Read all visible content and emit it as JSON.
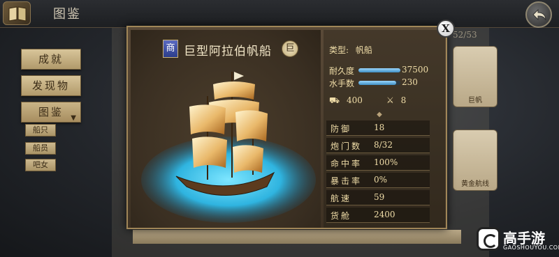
{
  "header": {
    "title": "图鉴"
  },
  "side_menu": {
    "items": [
      {
        "label": "成就"
      },
      {
        "label": "发现物"
      },
      {
        "label": "图鉴"
      }
    ],
    "sub_items": [
      {
        "label": "船只"
      },
      {
        "label": "船员"
      },
      {
        "label": "吧女"
      }
    ]
  },
  "collection": {
    "count": "52/53",
    "cards": [
      {
        "label": "巨帆"
      },
      {
        "label": ""
      },
      {
        "label": "黄金航线"
      }
    ]
  },
  "ship": {
    "type_badge": "商",
    "name": "巨型阿拉伯帆船",
    "size_badge": "巨",
    "type_label": "类型:",
    "type_value": "帆船",
    "durability_label": "耐久度",
    "durability_value": "37500",
    "durability_fraction": 1.0,
    "crew_label": "水手数",
    "crew_value": "230",
    "crew_fraction": 0.9,
    "cargo_value": "400",
    "weapons_value": "8",
    "attributes": [
      {
        "label": "防御",
        "value": "18"
      },
      {
        "label": "炮门数",
        "value": "8/32"
      },
      {
        "label": "命中率",
        "value": "100%"
      },
      {
        "label": "暴击率",
        "value": "0%"
      },
      {
        "label": "航速",
        "value": "59"
      },
      {
        "label": "货舱",
        "value": "2400"
      }
    ]
  },
  "close_symbol": "X",
  "watermark": {
    "text": "高手游",
    "sub": "GAOSHOUYOU.COM"
  },
  "colors": {
    "accent": "#a08658",
    "bar": "#3f8fc4"
  }
}
